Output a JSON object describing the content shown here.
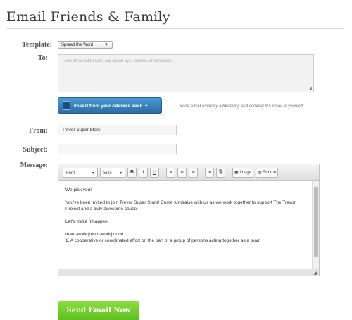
{
  "page": {
    "title": "Email Friends & Family"
  },
  "form": {
    "template_label": "Template:",
    "template_value": "Spread the Word",
    "to_label": "To:",
    "to_placeholder": "Add email addresses separated by a comma or semicolon.",
    "import_button": "Import from your Address book",
    "hint": "Send a test email by addressing and sending the email to yourself.",
    "from_label": "From:",
    "from_value": "Trevor Super Stars",
    "subject_label": "Subject:",
    "subject_value": "",
    "message_label": "Message:"
  },
  "toolbar": {
    "font": "Font",
    "size": "Size",
    "bold": "B",
    "italic": "I",
    "underline": "U",
    "image": "Image",
    "source": "Source"
  },
  "message": {
    "lines": [
      "We pick you!",
      "You've been invited to join Trevor Super Stars! Come fundraise with us as we work together to support The Trevor Project and a truly awesome cause.",
      "Let's make it happen!",
      "team-work [teem-wurk] noun",
      "1. A cooperative or coordinated effort on the part of a group of persons acting together as a team"
    ]
  },
  "send_button": "Send Email Now"
}
